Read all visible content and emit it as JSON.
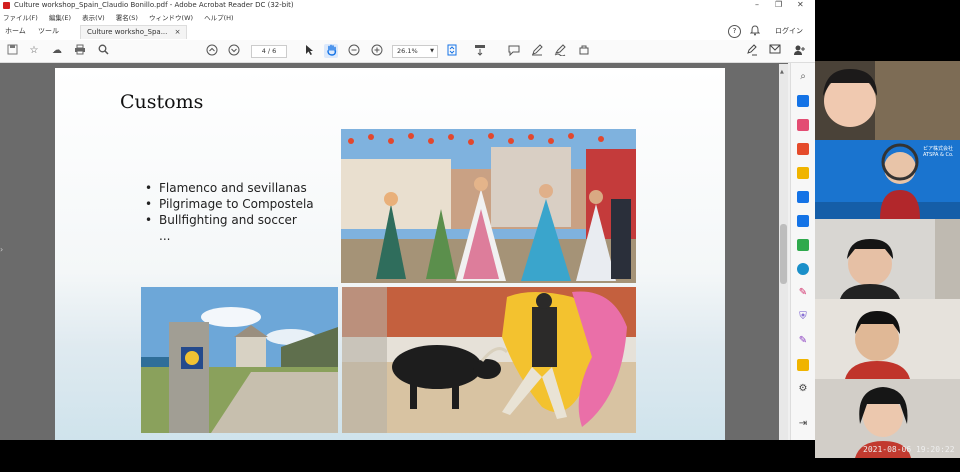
{
  "window": {
    "title": "Culture workshop_Spain_Claudio Bonillo.pdf - Adobe Acrobat Reader DC (32-bit)",
    "controls": [
      "–",
      "❐",
      "✕"
    ]
  },
  "menu": [
    "ファイル(F)",
    "編集(E)",
    "表示(V)",
    "署名(S)",
    "ウィンドウ(W)",
    "ヘルプ(H)"
  ],
  "tabs": {
    "home": "ホーム",
    "tools": "ツール",
    "doc": "Culture worksho_Spa...",
    "close": "×"
  },
  "header_right": {
    "help": "?",
    "bell": "🔔",
    "login": "ログイン"
  },
  "toolbar": {
    "page_current": "4",
    "page_total": "/ 6",
    "zoom": "26.1%"
  },
  "slide": {
    "title": "Customs",
    "bullets": [
      "Flamenco and sevillanas",
      "Pilgrimage to Compostela",
      "Bullfighting and soccer",
      "..."
    ]
  },
  "video": {
    "timestamp": "2021-08-06  19:20:22",
    "banner_text": "ピア株式会社 ATSPA & Co."
  },
  "colors": {
    "accent_blue": "#1473e6",
    "title_bg": "#ffffff",
    "doc_bg": "#6b6b6b"
  }
}
